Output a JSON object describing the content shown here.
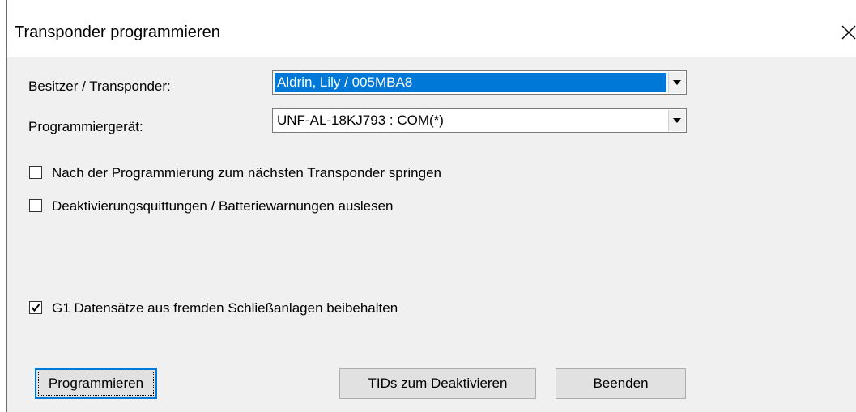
{
  "window": {
    "title": "Transponder programmieren"
  },
  "form": {
    "owner_label": "Besitzer / Transponder:",
    "owner_value": "Aldrin, Lily / 005MBA8",
    "device_label": "Programmiergerät:",
    "device_value": "UNF-AL-18KJ793 : COM(*)"
  },
  "options": [
    {
      "label": "Nach der Programmierung zum nächsten Transponder springen",
      "checked": false
    },
    {
      "label": "Deaktivierungsquittungen / Batteriewarnungen auslesen",
      "checked": false
    },
    {
      "label": "G1 Datensätze aus fremden Schließanlagen beibehalten",
      "checked": true
    }
  ],
  "buttons": {
    "program": "Programmieren",
    "tids": "TIDs zum Deaktivieren",
    "close": "Beenden"
  },
  "icons": {
    "close": "close-icon",
    "dropdown": "chevron-down-icon",
    "check": "checkmark-icon"
  },
  "colors": {
    "selection": "#0078d7",
    "dialog_bg": "#f0f0f0",
    "button_bg": "#e1e1e1"
  }
}
